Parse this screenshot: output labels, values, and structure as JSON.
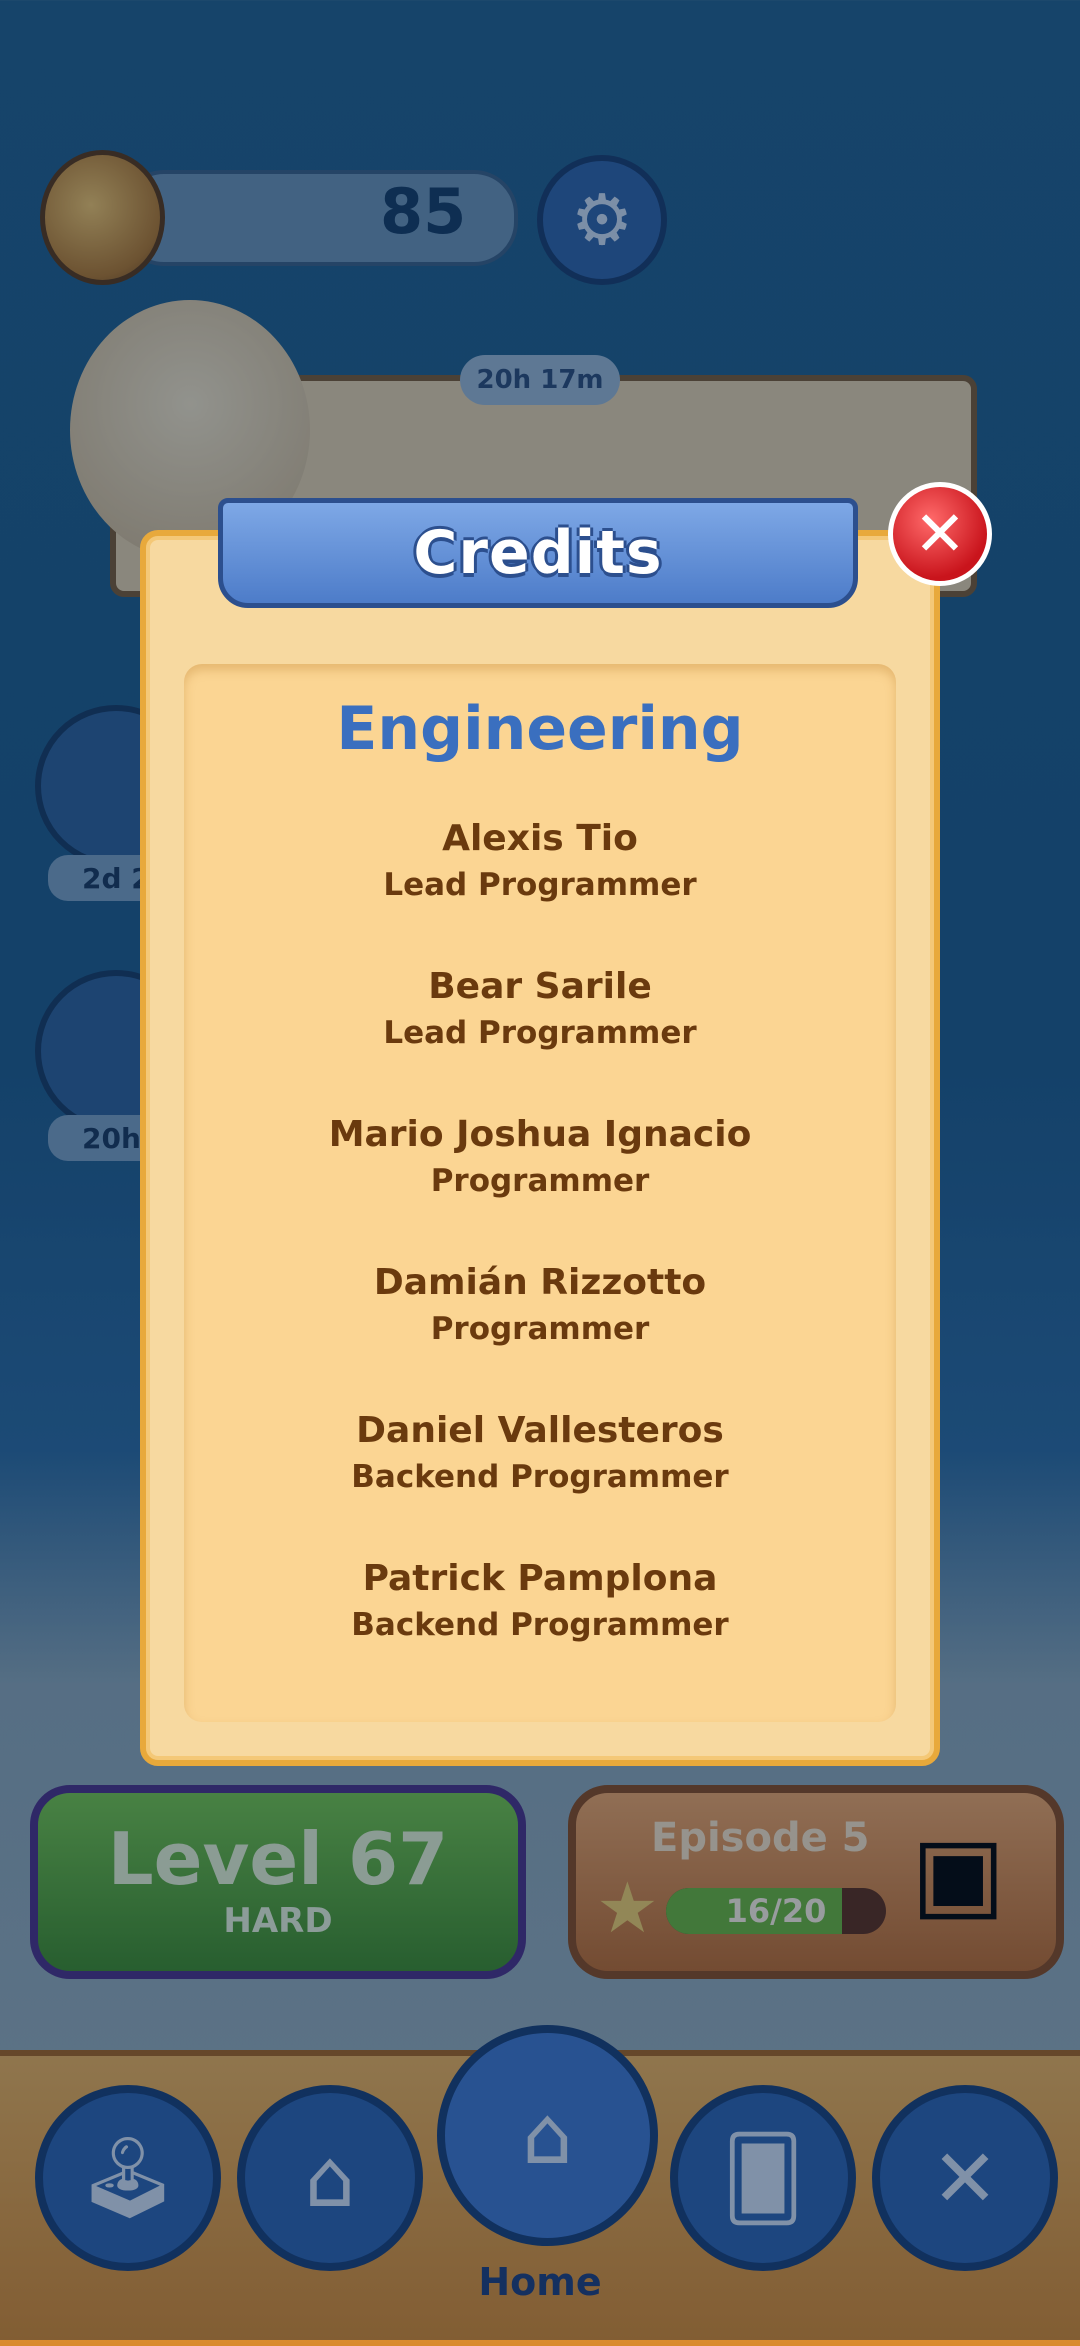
{
  "hud": {
    "coin_count": "85",
    "settings_icon": "gear-icon"
  },
  "event_banner": {
    "timer": "20h 17m"
  },
  "side_events": [
    {
      "icon": "trophy-icon",
      "timer": "2d 2"
    },
    {
      "icon": "creature-icon",
      "timer": "20h 1"
    }
  ],
  "level": {
    "title": "Level 67",
    "difficulty": "HARD"
  },
  "episode": {
    "title": "Episode 5",
    "progress_label": "16/20",
    "progress_fraction": 0.8
  },
  "bottom_nav": {
    "items": [
      {
        "icon": "joystick-icon"
      },
      {
        "icon": "hanger-icon"
      },
      {
        "icon": "pineapple-home-icon",
        "label": "Home"
      },
      {
        "icon": "cards-icon"
      },
      {
        "icon": "locked-chain-icon"
      }
    ]
  },
  "credits_modal": {
    "title": "Credits",
    "close_icon": "close-x-icon",
    "section_title": "Engineering",
    "entries": [
      {
        "name": "Alexis Tio",
        "role": "Lead Programmer"
      },
      {
        "name": "Bear Sarile",
        "role": "Lead Programmer"
      },
      {
        "name": "Mario Joshua Ignacio",
        "role": "Programmer"
      },
      {
        "name": "Damián Rizzotto",
        "role": "Programmer"
      },
      {
        "name": "Daniel Vallesteros",
        "role": "Backend Programmer"
      },
      {
        "name": "Patrick Pamplona",
        "role": "Backend Programmer"
      }
    ]
  }
}
